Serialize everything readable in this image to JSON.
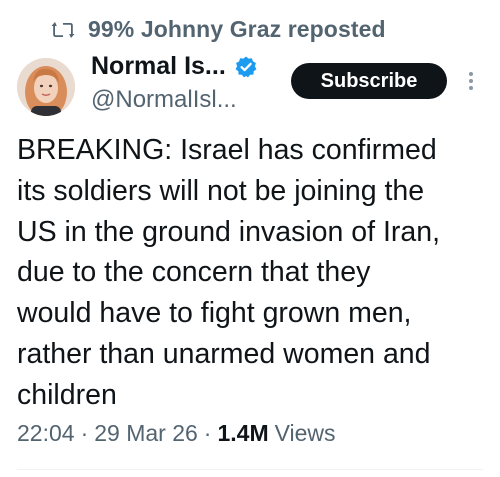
{
  "repost": {
    "text": "99% Johnny Graz reposted",
    "icon": "repost-icon"
  },
  "author": {
    "display_name": "Normal Is...",
    "handle": "@NormalIsl...",
    "verified": true,
    "avatar_icon": "avatar"
  },
  "actions": {
    "subscribe_label": "Subscribe",
    "more_icon": "more-options-icon"
  },
  "post": {
    "text": "BREAKING: Israel has confirmed\nits soldiers will not be joining the\nUS in the ground invasion of Iran,\ndue to the concern that they\nwould have to fight grown men,\nrather than unarmed women and\nchildren"
  },
  "meta": {
    "time": "22:04",
    "date": "29 Mar 26",
    "separator": "·",
    "views_count": "1.4M",
    "views_label": "Views"
  },
  "colors": {
    "text_primary": "#0f1419",
    "text_secondary": "#536471",
    "verified_blue": "#1d9bf0",
    "button_bg": "#0f1419"
  }
}
